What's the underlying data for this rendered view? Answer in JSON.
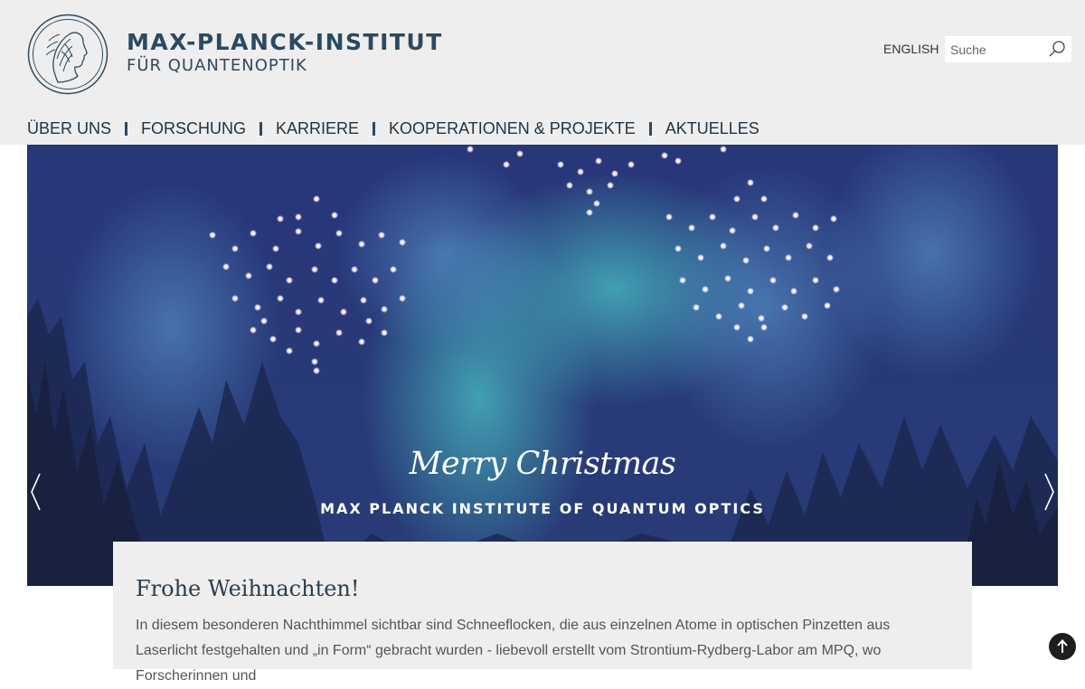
{
  "header": {
    "institute_name": "MAX-PLANCK-INSTITUT",
    "institute_sub": "FÜR QUANTENOPTIK",
    "language_link": "ENGLISH",
    "search_placeholder": "Suche"
  },
  "nav": {
    "items": [
      {
        "label": "ÜBER UNS"
      },
      {
        "label": "FORSCHUNG"
      },
      {
        "label": "KARRIERE"
      },
      {
        "label": "KOOPERATIONEN & PROJEKTE"
      },
      {
        "label": "AKTUELLES"
      }
    ]
  },
  "hero": {
    "title": "Merry Christmas",
    "subtitle": "MAX PLANCK INSTITUTE OF QUANTUM OPTICS"
  },
  "card": {
    "title": "Frohe Weihnachten!",
    "text": "In diesem besonderen Nachthimmel sichtbar sind Schneeflocken, die aus einzelnen Atome in optischen Pinzetten aus Laserlicht festgehalten und „in Form“ gebracht wurden - liebevoll erstellt vom Strontium-Rydberg-Labor am MPQ, wo Forscherinnen und"
  },
  "colors": {
    "brand": "#2b4a62",
    "header_bg": "#eeeeee",
    "sky_top": "#28367a",
    "sky_bottom": "#283c76",
    "aurora": "#3fa8b8"
  },
  "icons": {
    "logo": "minerva-logo",
    "search": "search-icon",
    "prev": "chevron-left-icon",
    "next": "chevron-right-icon",
    "back_to_top": "arrow-up-icon"
  }
}
